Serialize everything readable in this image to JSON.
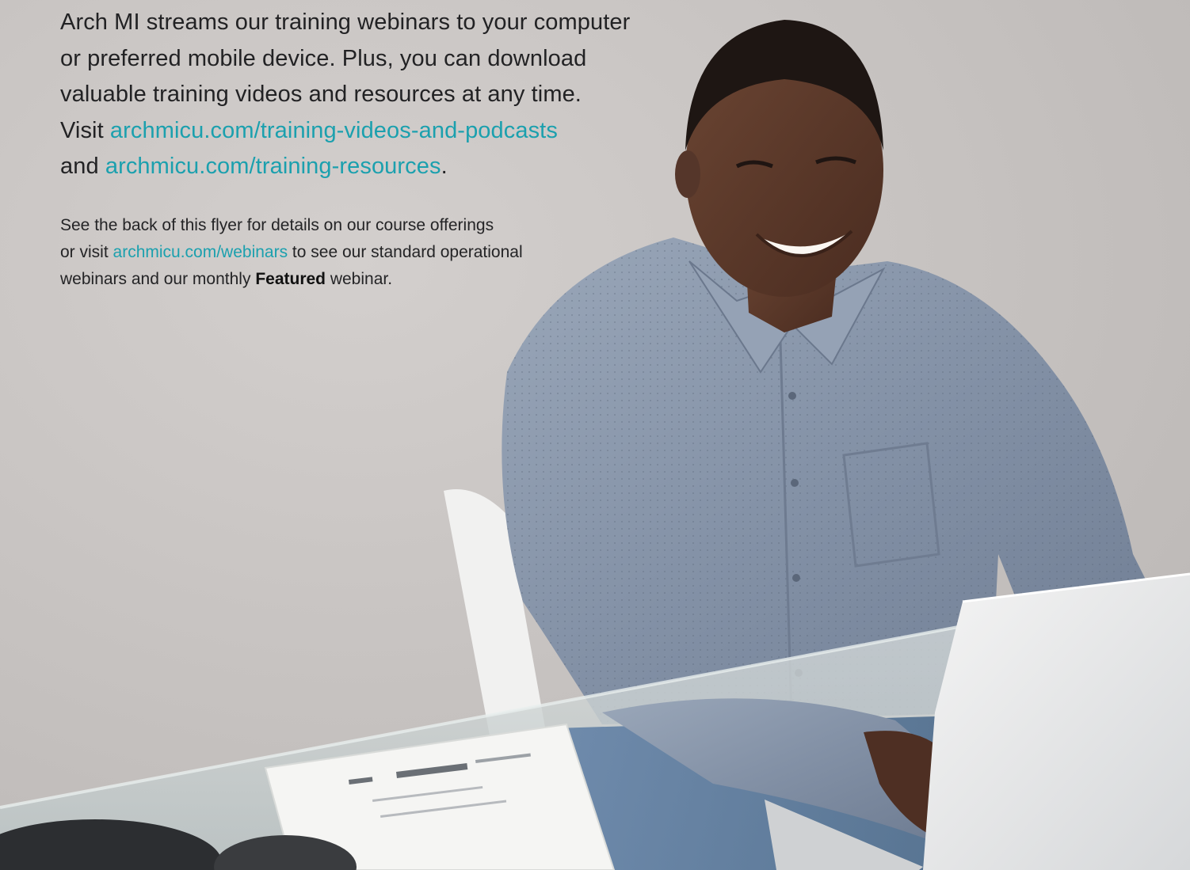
{
  "lead": {
    "line1": "Arch MI streams our training webinars to your computer",
    "line2": "or preferred mobile device. Plus, you can download",
    "line3": "valuable training videos and resources at any time.",
    "line4_prefix": "Visit ",
    "link_videos": "archmicu.com/training-videos-and-podcasts",
    "line5_prefix": "and ",
    "link_resources": "archmicu.com/training-resources",
    "line5_suffix": "."
  },
  "note": {
    "line1": "See the back of this flyer for details on our course offerings",
    "line2_prefix": "or visit ",
    "link_webinars": "archmicu.com/webinars",
    "line2_suffix": " to see our standard operational",
    "line3_prefix": "webinars and our monthly ",
    "line3_bold": "Featured",
    "line3_suffix": " webinar."
  },
  "colors": {
    "link": "#1ba0ae",
    "text": "#222224",
    "wall": "#c9c5c4",
    "shirt": "#8796ab"
  },
  "illustration": {
    "subject": "smiling man in grey-blue shirt working on laptop at glass desk with papers"
  }
}
